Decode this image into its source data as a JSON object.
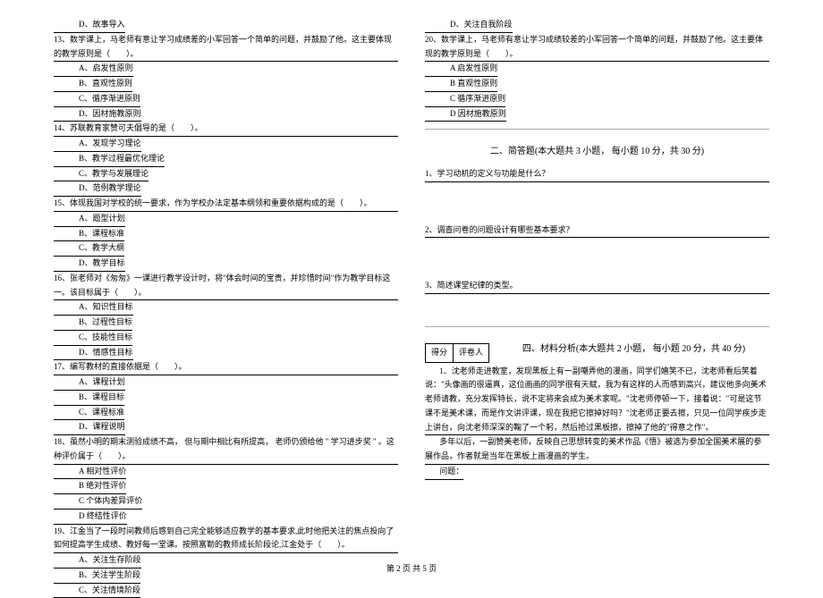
{
  "left": {
    "q12_d": "D、故事导入",
    "q13_stem": "13、数学课上，马老师有意让学习成绩差的小军回答一个简单的问题，并鼓励了他。这主要体现的教学原则是（　　）。",
    "q13_a": "A、启发性原则",
    "q13_b": "B、直观性原则",
    "q13_c": "C、循序渐进原则",
    "q13_d": "D、因材施教原则",
    "q14_stem": "14、苏联教育家赞可夫倡导的是（　　）。",
    "q14_a": "A、发现学习理论",
    "q14_b": "B、教学过程最优化理论",
    "q14_c": "C、教学与发展理论",
    "q14_d": "D、范例教学理论",
    "q15_stem": "15、体现我国对学校的统一要求，作为学校办法定基本纲领和重要依据构成的是（　　）。",
    "q15_a": "A、题型计划",
    "q15_b": "B、课程标准",
    "q15_c": "C、教学大纲",
    "q15_d": "D、教学目标",
    "q16_stem": "16、张老师对《匆匆》一课进行教学设计时，将\"体会时间的宝贵，并珍惜时间\"作为教学目标这一。该目标属于（　　）。",
    "q16_a": "A、知识性目标",
    "q16_b": "B、过程性目标",
    "q16_c": "C、技能性目标",
    "q16_d": "D、情感性目标",
    "q17_stem": "17、编写教材的直接依据是（　　）。",
    "q17_a": "A、课程计划",
    "q17_b": "B、课程目标",
    "q17_c": "C、课程标准",
    "q17_d": "D、课程说明",
    "q18_stem": "18、虽然小明的期末测验成绩不高， 但与期中相比有所提高， 老师仍颁给他 \" 学习进步奖 \" 。这种评价属于（　　）。",
    "q18_a": "A  相对性评价",
    "q18_b": "B  绝对性评价",
    "q18_c": "C  个体内差异评价",
    "q18_d": "D  终结性评价",
    "q19_stem": "19、江金当了一段时间教师后感到自己完全能够适应教学的基本要求,此时他把关注的焦点投向了如何提高学生成绩、教好每一堂课。按照富勒的教师成长阶段论,江金处于（　　）。",
    "q19_a": "A、关注生存阶段",
    "q19_b": "B、关注学生阶段",
    "q19_c": "C、关注情境阶段"
  },
  "right": {
    "q19_d": "D、关注自我阶段",
    "q20_stem": "20、数学课上，马老师有意让学习成绩较差的小军回答一个简单的问题，并鼓励了他。这主要体现的教学原则是（　　）。",
    "q20_a": "A  启发性原则",
    "q20_b": "B  直观性原则",
    "q20_c": "C  循序渐进原则",
    "q20_d": "D  因材施教原则",
    "section2_title": "二、简答题(本大题共 3 小题，  每小题 10 分，共 30 分)",
    "sq1": "1、学习动机的定义与功能是什么？",
    "sq2": "2、调查问卷的问题设计有哪些基本要求？",
    "sq3": "3、简述课堂纪律的类型。",
    "score_label1": "得分",
    "score_label2": "评卷人",
    "section4_title": "四、材料分析(本大题共 2 小题，  每小题 20 分，共 40 分)",
    "m1_p1": "1、沈老师走进教室，发现黑板上有一副嘲弄他的漫画，同学们嬉笑不已，沈老师看后笑着说：\"头像画的很逼真，这位画画的同学很有天赋，我为有这样的人而感到高兴，建议他多向美术老师请教，充分发挥特长，说不定将来会成为美术家呢。\"沈老师停顿一下，接着说：\"可是这节课不是美术课，而是作文讲评课，现在我把它擦掉好吗？\"沈老师正要去擦，只见一位同学疾步走上讲台，向沈老师深深的鞠了一个躬，然后抢过黑板擦，擦掉了他的\"得意之作\"。",
    "m1_p2": "多年以后，一副赞美老师，反映自己思想转变的美术作品《悟》被选为参加全国美术展的参展作品，作者就是当年在黑板上画漫画的学生。",
    "m1_q": "问题："
  },
  "footer": "第 2 页 共 5 页"
}
